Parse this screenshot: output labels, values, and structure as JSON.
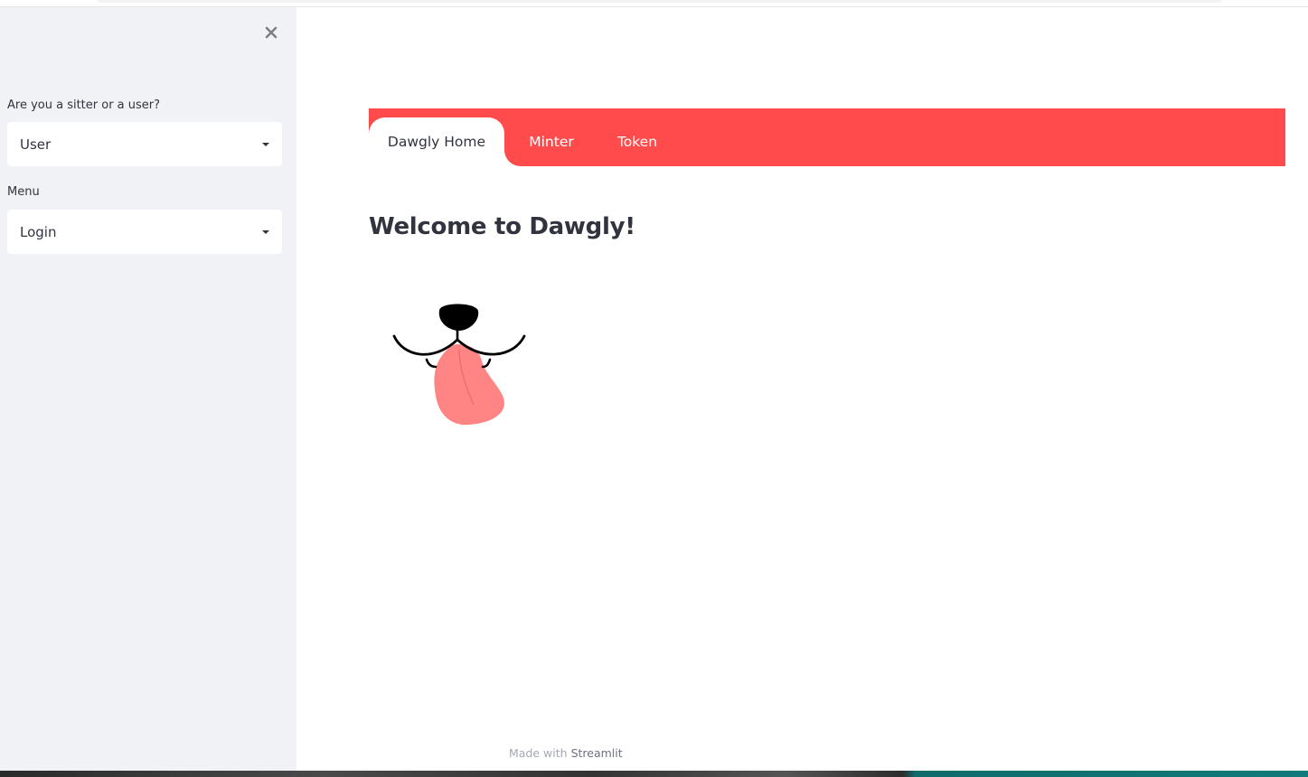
{
  "sidebar": {
    "role_label": "Are you a sitter or a user?",
    "role_value": "User",
    "menu_label": "Menu",
    "menu_value": "Login"
  },
  "tabs": [
    {
      "label": "Dawgly Home",
      "active": true
    },
    {
      "label": "Minter",
      "active": false
    },
    {
      "label": "Token",
      "active": false
    }
  ],
  "main": {
    "title": "Welcome to Dawgly!",
    "image_icon": "dog-mouth-tongue-icon"
  },
  "footer": {
    "prefix": "Made with",
    "brand": "Streamlit"
  },
  "colors": {
    "accent": "#ff4b4b",
    "sidebar_bg": "#f0f2f6",
    "text": "#31333f",
    "tongue": "#ff8585"
  }
}
